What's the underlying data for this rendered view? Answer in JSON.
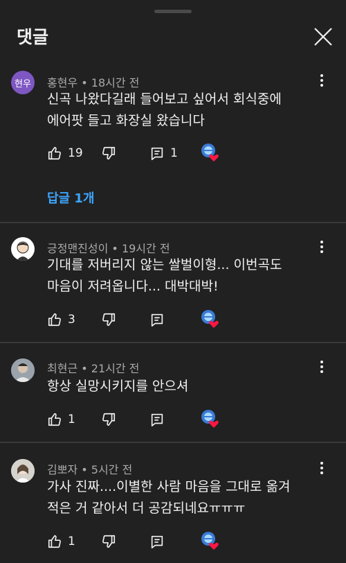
{
  "header": {
    "title": "댓글"
  },
  "comments": [
    {
      "author": "홍현우",
      "separator": " • ",
      "time": "18시간 전",
      "avatar_text": "현우",
      "lines": [
        "신곡 나왔다길래 들어보고 싶어서 회식중에",
        "에어팟 들고 화장실 왔습니다"
      ],
      "likes": "19",
      "reply_count": "1",
      "replies_label": "답글 1개"
    },
    {
      "author": "긍정맨진성이",
      "separator": " • ",
      "time": "19시간 전",
      "lines": [
        "기대를 저버리지 않는 쌀벌이형...  이번곡도",
        "마음이 저려옵니다... 대박대박!"
      ],
      "likes": "3"
    },
    {
      "author": "최현근",
      "separator": " • ",
      "time": "21시간 전",
      "lines": [
        "항상 실망시키지를 안으셔"
      ],
      "likes": "1"
    },
    {
      "author": "김뽀자",
      "separator": " • ",
      "time": "5시간 전",
      "lines": [
        "가사 진짜....이별한 사람 마음을 그대로 옮겨",
        "적은 거 같아서 더 공감되네요ㅠㅠㅠ"
      ],
      "likes": "1"
    }
  ],
  "colors": {
    "background": "#212121",
    "link": "#3ea6ff",
    "avatar_purple": "#7e57c2",
    "heart": "#ff1744"
  }
}
